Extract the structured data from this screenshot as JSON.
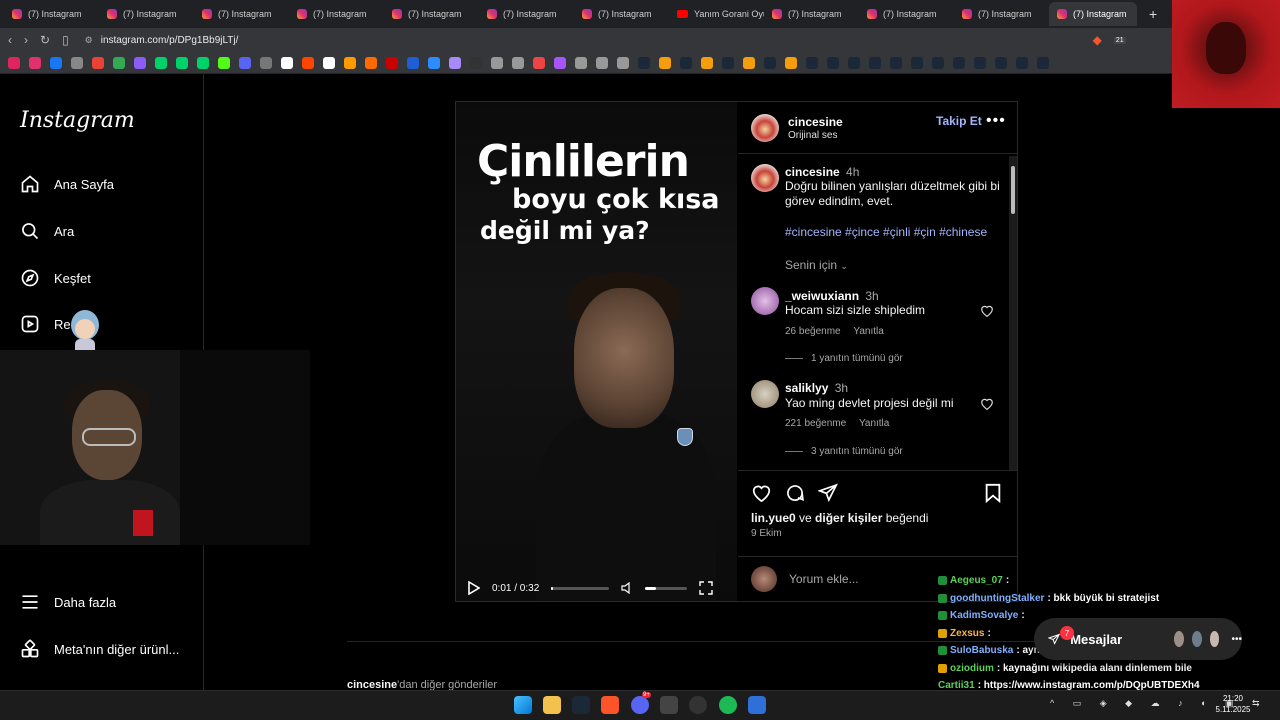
{
  "browser": {
    "tabs": [
      {
        "label": "(7) Instagram",
        "kind": "ig"
      },
      {
        "label": "(7) Instagram",
        "kind": "ig"
      },
      {
        "label": "(7) Instagram",
        "kind": "ig"
      },
      {
        "label": "(7) Instagram",
        "kind": "ig"
      },
      {
        "label": "(7) Instagram",
        "kind": "ig"
      },
      {
        "label": "(7) Instagram",
        "kind": "ig"
      },
      {
        "label": "(7) Instagram",
        "kind": "ig"
      },
      {
        "label": "Yanım Gorani Oyun",
        "kind": "yt"
      },
      {
        "label": "(7) Instagram",
        "kind": "ig"
      },
      {
        "label": "(7) Instagram",
        "kind": "ig"
      },
      {
        "label": "(7) Instagram",
        "kind": "ig"
      }
    ],
    "active_tab": "(7) Instagram",
    "url": "instagram.com/p/DPg1Bb9jLTj/",
    "extension_count": "21"
  },
  "sidebar": {
    "logo": "Instagram",
    "items": [
      {
        "label": "Ana Sayfa",
        "icon": "home-icon"
      },
      {
        "label": "Ara",
        "icon": "search-icon"
      },
      {
        "label": "Keşfet",
        "icon": "compass-icon"
      },
      {
        "label": "Re",
        "icon": "reels-icon"
      }
    ],
    "bottom_items": [
      {
        "label": "Daha fazla",
        "icon": "menu-icon"
      },
      {
        "label": "Meta'nın diğer ürünl...",
        "icon": "meta-apps-icon"
      }
    ]
  },
  "video": {
    "line1": "Çinlilerin",
    "line2": "boyu çok kısa",
    "line3": "değil mi ya?",
    "time": "0:01 / 0:32",
    "progress": 0.03,
    "volume": 0.25
  },
  "post": {
    "author": "cincesine",
    "audio": "Orijinal ses",
    "follow": "Takip Et",
    "caption_user": "cincesine",
    "caption_time": "4h",
    "caption": "Doğru bilinen yanlışları düzeltmek gibi bi görev edindim, evet.",
    "hashtags": "#cincesine #çince #çinli #çin #chinese",
    "for_you": "Senin için",
    "comments": [
      {
        "user": "_weiwuxiann",
        "time": "3h",
        "text": "Hocam sizi sizle shipledim",
        "likes": "26 beğenme",
        "reply": "Yanıtla",
        "view_replies": "1 yanıtın tümünü gör"
      },
      {
        "user": "saliklyy",
        "time": "3h",
        "text": "Yao ming devlet projesi değil mi",
        "likes": "221 beğenme",
        "reply": "Yanıtla",
        "view_replies": "3 yanıtın tümünü gör"
      }
    ],
    "liked_by_user": "lin.yue0",
    "liked_by_mid": " ve ",
    "liked_by_others": "diğer kişiler",
    "liked_by_end": " beğendi",
    "date": "9 Ekim",
    "comment_placeholder": "Yorum ekle..."
  },
  "below": {
    "more_user": "cincesine",
    "more_text": "'dan diğer gönderiler"
  },
  "messages": {
    "label": "Mesajlar",
    "badge": "7"
  },
  "chat": [
    {
      "user": "Aegeus_07",
      "text": ":",
      "color": "#5bd15b",
      "badge": "#1f8f3a"
    },
    {
      "user": "goodhuntingStalker",
      "text": ": bkk büyük bi stratejist",
      "color": "#7fb0ff",
      "badge": "#1f8f3a"
    },
    {
      "user": "KadimSovalye",
      "text": ":",
      "color": "#7fb0ff",
      "badge": "#1f8f3a"
    },
    {
      "user": "Zexsus",
      "text": ":",
      "color": "#ffb347",
      "badge": "#e0a100"
    },
    {
      "user": "SuloBabuska",
      "text": ": aynı şey amk",
      "color": "#7fb0ff",
      "badge": "#1f8f3a"
    },
    {
      "user": "oziodium",
      "text": ": kaynağını wikipedia alanı dinlemem bile",
      "color": "#5bd15b",
      "badge": "#e0a100"
    },
    {
      "user": "Cartii31",
      "text": ": https://www.instagram.com/p/DQpUBTDEXh4",
      "color": "#5bd15b",
      "badge": ""
    }
  ],
  "taskbar": {
    "time": "21:20",
    "date": "5.11.2025",
    "discord_badge": "9+"
  },
  "colors": {
    "accent_link": "#a5b4fc",
    "follow": "#a5b4fc",
    "notification": "#ff3040"
  }
}
